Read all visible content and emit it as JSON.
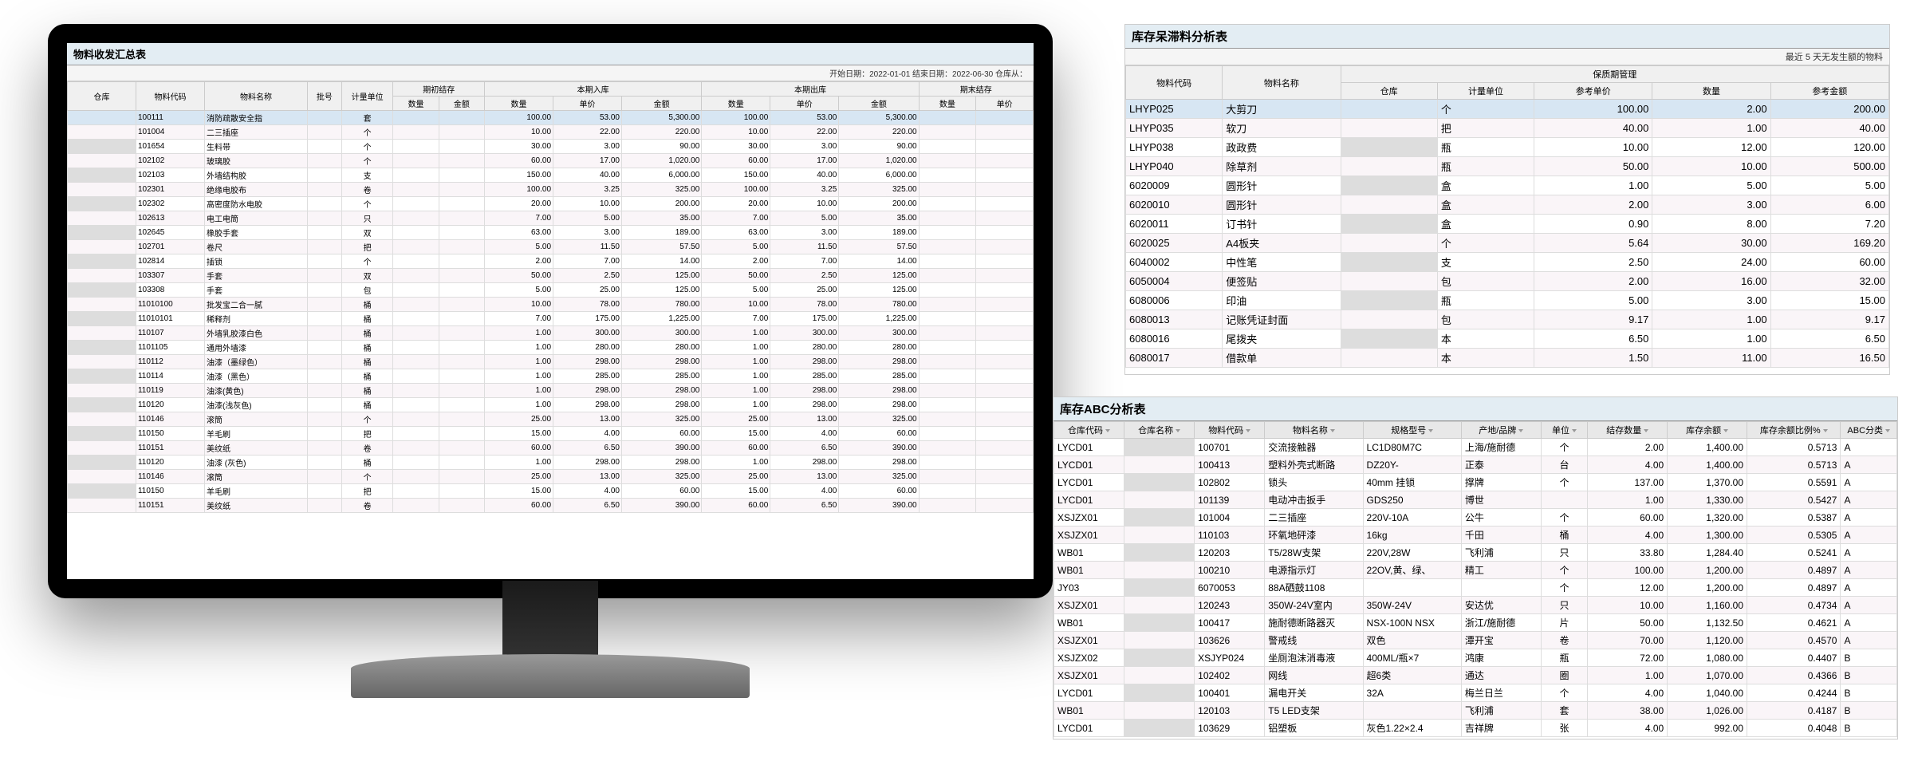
{
  "report1": {
    "title": "物料收发汇总表",
    "date_label": "开始日期：2022-01-01 结束日期：2022-06-30 仓库从：",
    "header_group1": "期初结存",
    "header_group2": "本期入库",
    "header_group3": "本期出库",
    "header_group4": "期末结存",
    "cols": {
      "c1": "仓库",
      "c2": "物料代码",
      "c3": "物料名称",
      "c4": "批号",
      "c5": "计量单位",
      "c6": "数量",
      "c7": "金额",
      "c8": "数量",
      "c9": "单价",
      "c10": "金额",
      "c11": "数量",
      "c12": "单价",
      "c13": "金额",
      "c14": "数量",
      "c15": "单价"
    },
    "rows": [
      {
        "code": "100111",
        "name": "消防疏散安全指",
        "unit": "套",
        "in_qty": "100.00",
        "in_price": "53.00",
        "in_amt": "5,300.00",
        "out_qty": "100.00",
        "out_price": "53.00",
        "out_amt": "5,300.00",
        "hl": true
      },
      {
        "code": "101004",
        "name": "二三插座",
        "unit": "个",
        "in_qty": "10.00",
        "in_price": "22.00",
        "in_amt": "220.00",
        "out_qty": "10.00",
        "out_price": "22.00",
        "out_amt": "220.00"
      },
      {
        "code": "101654",
        "name": "生料带",
        "unit": "个",
        "in_qty": "30.00",
        "in_price": "3.00",
        "in_amt": "90.00",
        "out_qty": "30.00",
        "out_price": "3.00",
        "out_amt": "90.00"
      },
      {
        "code": "102102",
        "name": "玻璃胶",
        "unit": "个",
        "in_qty": "60.00",
        "in_price": "17.00",
        "in_amt": "1,020.00",
        "out_qty": "60.00",
        "out_price": "17.00",
        "out_amt": "1,020.00"
      },
      {
        "code": "102103",
        "name": "外墙结构胶",
        "unit": "支",
        "in_qty": "150.00",
        "in_price": "40.00",
        "in_amt": "6,000.00",
        "out_qty": "150.00",
        "out_price": "40.00",
        "out_amt": "6,000.00"
      },
      {
        "code": "102301",
        "name": "绝缘电胶布",
        "unit": "卷",
        "in_qty": "100.00",
        "in_price": "3.25",
        "in_amt": "325.00",
        "out_qty": "100.00",
        "out_price": "3.25",
        "out_amt": "325.00"
      },
      {
        "code": "102302",
        "name": "高密度防水电胶",
        "unit": "个",
        "in_qty": "20.00",
        "in_price": "10.00",
        "in_amt": "200.00",
        "out_qty": "20.00",
        "out_price": "10.00",
        "out_amt": "200.00"
      },
      {
        "code": "102613",
        "name": "电工电筒",
        "unit": "只",
        "in_qty": "7.00",
        "in_price": "5.00",
        "in_amt": "35.00",
        "out_qty": "7.00",
        "out_price": "5.00",
        "out_amt": "35.00"
      },
      {
        "code": "102645",
        "name": "橡胶手套",
        "unit": "双",
        "in_qty": "63.00",
        "in_price": "3.00",
        "in_amt": "189.00",
        "out_qty": "63.00",
        "out_price": "3.00",
        "out_amt": "189.00"
      },
      {
        "code": "102701",
        "name": "卷尺",
        "unit": "把",
        "in_qty": "5.00",
        "in_price": "11.50",
        "in_amt": "57.50",
        "out_qty": "5.00",
        "out_price": "11.50",
        "out_amt": "57.50"
      },
      {
        "code": "102814",
        "name": "插锁",
        "unit": "个",
        "in_qty": "2.00",
        "in_price": "7.00",
        "in_amt": "14.00",
        "out_qty": "2.00",
        "out_price": "7.00",
        "out_amt": "14.00"
      },
      {
        "code": "103307",
        "name": "手套",
        "unit": "双",
        "in_qty": "50.00",
        "in_price": "2.50",
        "in_amt": "125.00",
        "out_qty": "50.00",
        "out_price": "2.50",
        "out_amt": "125.00"
      },
      {
        "code": "103308",
        "name": "手套",
        "unit": "包",
        "in_qty": "5.00",
        "in_price": "25.00",
        "in_amt": "125.00",
        "out_qty": "5.00",
        "out_price": "25.00",
        "out_amt": "125.00"
      },
      {
        "code": "11010100",
        "name": "批发宝二合一腻",
        "unit": "桶",
        "in_qty": "10.00",
        "in_price": "78.00",
        "in_amt": "780.00",
        "out_qty": "10.00",
        "out_price": "78.00",
        "out_amt": "780.00"
      },
      {
        "code": "11010101",
        "name": "稀释剂",
        "unit": "桶",
        "in_qty": "7.00",
        "in_price": "175.00",
        "in_amt": "1,225.00",
        "out_qty": "7.00",
        "out_price": "175.00",
        "out_amt": "1,225.00"
      },
      {
        "code": "110107",
        "name": "外墙乳胶漆白色",
        "unit": "桶",
        "in_qty": "1.00",
        "in_price": "300.00",
        "in_amt": "300.00",
        "out_qty": "1.00",
        "out_price": "300.00",
        "out_amt": "300.00"
      },
      {
        "code": "1101105",
        "name": "通用外墙漆",
        "unit": "桶",
        "in_qty": "1.00",
        "in_price": "280.00",
        "in_amt": "280.00",
        "out_qty": "1.00",
        "out_price": "280.00",
        "out_amt": "280.00"
      },
      {
        "code": "110112",
        "name": "油漆（墨绿色）",
        "unit": "桶",
        "in_qty": "1.00",
        "in_price": "298.00",
        "in_amt": "298.00",
        "out_qty": "1.00",
        "out_price": "298.00",
        "out_amt": "298.00"
      },
      {
        "code": "110114",
        "name": "油漆（黑色）",
        "unit": "桶",
        "in_qty": "1.00",
        "in_price": "285.00",
        "in_amt": "285.00",
        "out_qty": "1.00",
        "out_price": "285.00",
        "out_amt": "285.00"
      },
      {
        "code": "110119",
        "name": "油漆(黄色)",
        "unit": "桶",
        "in_qty": "1.00",
        "in_price": "298.00",
        "in_amt": "298.00",
        "out_qty": "1.00",
        "out_price": "298.00",
        "out_amt": "298.00"
      },
      {
        "code": "110120",
        "name": "油漆(浅灰色)",
        "unit": "桶",
        "in_qty": "1.00",
        "in_price": "298.00",
        "in_amt": "298.00",
        "out_qty": "1.00",
        "out_price": "298.00",
        "out_amt": "298.00"
      },
      {
        "code": "110146",
        "name": "滚筒",
        "unit": "个",
        "in_qty": "25.00",
        "in_price": "13.00",
        "in_amt": "325.00",
        "out_qty": "25.00",
        "out_price": "13.00",
        "out_amt": "325.00"
      },
      {
        "code": "110150",
        "name": "羊毛刷",
        "unit": "把",
        "in_qty": "15.00",
        "in_price": "4.00",
        "in_amt": "60.00",
        "out_qty": "15.00",
        "out_price": "4.00",
        "out_amt": "60.00"
      },
      {
        "code": "110151",
        "name": "美纹纸",
        "unit": "卷",
        "in_qty": "60.00",
        "in_price": "6.50",
        "in_amt": "390.00",
        "out_qty": "60.00",
        "out_price": "6.50",
        "out_amt": "390.00"
      },
      {
        "code": "110120",
        "name": "油漆 (灰色)",
        "unit": "桶",
        "in_qty": "1.00",
        "in_price": "298.00",
        "in_amt": "298.00",
        "out_qty": "1.00",
        "out_price": "298.00",
        "out_amt": "298.00"
      },
      {
        "code": "110146",
        "name": "滚筒",
        "unit": "个",
        "in_qty": "25.00",
        "in_price": "13.00",
        "in_amt": "325.00",
        "out_qty": "25.00",
        "out_price": "13.00",
        "out_amt": "325.00"
      },
      {
        "code": "110150",
        "name": "羊毛刷",
        "unit": "把",
        "in_qty": "15.00",
        "in_price": "4.00",
        "in_amt": "60.00",
        "out_qty": "15.00",
        "out_price": "4.00",
        "out_amt": "60.00"
      },
      {
        "code": "110151",
        "name": "美纹纸",
        "unit": "卷",
        "in_qty": "60.00",
        "in_price": "6.50",
        "in_amt": "390.00",
        "out_qty": "60.00",
        "out_price": "6.50",
        "out_amt": "390.00"
      }
    ]
  },
  "report2": {
    "title": "库存呆滞料分析表",
    "subtitle": "最近 5 天无发生额的物料",
    "header_group": "保质期管理",
    "cols": {
      "c1": "物料代码",
      "c2": "物料名称",
      "c3": "仓库",
      "c4": "计量单位",
      "c5": "参考单价",
      "c6": "数量",
      "c7": "参考金额"
    },
    "rows": [
      {
        "code": "LHYP025",
        "name": "大剪刀",
        "unit": "个",
        "price": "100.00",
        "qty": "2.00",
        "amt": "200.00",
        "hl": true
      },
      {
        "code": "LHYP035",
        "name": "软刀",
        "unit": "把",
        "price": "40.00",
        "qty": "1.00",
        "amt": "40.00"
      },
      {
        "code": "LHYP038",
        "name": "政政费",
        "unit": "瓶",
        "price": "10.00",
        "qty": "12.00",
        "amt": "120.00"
      },
      {
        "code": "LHYP040",
        "name": "除草剂",
        "unit": "瓶",
        "price": "50.00",
        "qty": "10.00",
        "amt": "500.00"
      },
      {
        "code": "6020009",
        "name": "圆形针",
        "unit": "盒",
        "price": "1.00",
        "qty": "5.00",
        "amt": "5.00"
      },
      {
        "code": "6020010",
        "name": "圆形针",
        "unit": "盒",
        "price": "2.00",
        "qty": "3.00",
        "amt": "6.00"
      },
      {
        "code": "6020011",
        "name": "订书针",
        "unit": "盒",
        "price": "0.90",
        "qty": "8.00",
        "amt": "7.20"
      },
      {
        "code": "6020025",
        "name": "A4板夹",
        "unit": "个",
        "price": "5.64",
        "qty": "30.00",
        "amt": "169.20"
      },
      {
        "code": "6040002",
        "name": "中性笔",
        "unit": "支",
        "price": "2.50",
        "qty": "24.00",
        "amt": "60.00"
      },
      {
        "code": "6050004",
        "name": "便签贴",
        "unit": "包",
        "price": "2.00",
        "qty": "16.00",
        "amt": "32.00"
      },
      {
        "code": "6080006",
        "name": "印油",
        "unit": "瓶",
        "price": "5.00",
        "qty": "3.00",
        "amt": "15.00"
      },
      {
        "code": "6080013",
        "name": "记账凭证封面",
        "unit": "包",
        "price": "9.17",
        "qty": "1.00",
        "amt": "9.17"
      },
      {
        "code": "6080016",
        "name": "尾拨夹",
        "unit": "本",
        "price": "6.50",
        "qty": "1.00",
        "amt": "6.50"
      },
      {
        "code": "6080017",
        "name": "借款单",
        "unit": "本",
        "price": "1.50",
        "qty": "11.00",
        "amt": "16.50"
      }
    ]
  },
  "report3": {
    "title": "库存ABC分析表",
    "cols": {
      "c1": "仓库代码",
      "c2": "仓库名称",
      "c3": "物料代码",
      "c4": "物料名称",
      "c5": "规格型号",
      "c6": "产地/品牌",
      "c7": "单位",
      "c8": "结存数量",
      "c9": "库存余额",
      "c10": "库存余额比例%",
      "c11": "ABC分类"
    },
    "rows": [
      {
        "wh": "LYCD01",
        "code": "100701",
        "name": "交流接触器",
        "spec": "LC1D80M7C",
        "brand": "上海/施耐德",
        "unit": "个",
        "qty": "2.00",
        "bal": "1,400.00",
        "pct": "0.5713",
        "abc": "A"
      },
      {
        "wh": "LYCD01",
        "code": "100413",
        "name": "塑料外壳式断路",
        "spec": "DZ20Y-",
        "brand": "正泰",
        "unit": "台",
        "qty": "4.00",
        "bal": "1,400.00",
        "pct": "0.5713",
        "abc": "A"
      },
      {
        "wh": "LYCD01",
        "code": "102802",
        "name": "锁头",
        "spec": "40mm 挂锁",
        "brand": "撑牌",
        "unit": "个",
        "qty": "137.00",
        "bal": "1,370.00",
        "pct": "0.5591",
        "abc": "A"
      },
      {
        "wh": "LYCD01",
        "code": "101139",
        "name": "电动冲击扳手",
        "spec": "GDS250",
        "brand": "博世",
        "unit": "",
        "qty": "1.00",
        "bal": "1,330.00",
        "pct": "0.5427",
        "abc": "A"
      },
      {
        "wh": "XSJZX01",
        "code": "101004",
        "name": "二三插座",
        "spec": "220V-10A",
        "brand": "公牛",
        "unit": "个",
        "qty": "60.00",
        "bal": "1,320.00",
        "pct": "0.5387",
        "abc": "A"
      },
      {
        "wh": "XSJZX01",
        "code": "110103",
        "name": "环氧地砰漆",
        "spec": "16kg",
        "brand": "千田",
        "unit": "桶",
        "qty": "4.00",
        "bal": "1,300.00",
        "pct": "0.5305",
        "abc": "A"
      },
      {
        "wh": "WB01",
        "code": "120203",
        "name": "T5/28W支架",
        "spec": "220V,28W",
        "brand": "飞利浦",
        "unit": "只",
        "qty": "33.80",
        "bal": "1,284.40",
        "pct": "0.5241",
        "abc": "A"
      },
      {
        "wh": "WB01",
        "code": "100210",
        "name": "电源指示灯",
        "spec": "22OV,黄、绿、",
        "brand": "精工",
        "unit": "个",
        "qty": "100.00",
        "bal": "1,200.00",
        "pct": "0.4897",
        "abc": "A"
      },
      {
        "wh": "JY03",
        "code": "6070053",
        "name": "88A硒鼓1108",
        "spec": "",
        "brand": "",
        "unit": "个",
        "qty": "12.00",
        "bal": "1,200.00",
        "pct": "0.4897",
        "abc": "A"
      },
      {
        "wh": "XSJZX01",
        "code": "120243",
        "name": "350W-24V室内",
        "spec": "350W-24V",
        "brand": "安达优",
        "unit": "只",
        "qty": "10.00",
        "bal": "1,160.00",
        "pct": "0.4734",
        "abc": "A"
      },
      {
        "wh": "WB01",
        "code": "100417",
        "name": "施耐德断路器灭",
        "spec": "NSX-100N NSX",
        "brand": "浙江/施耐德",
        "unit": "片",
        "qty": "50.00",
        "bal": "1,132.50",
        "pct": "0.4621",
        "abc": "A"
      },
      {
        "wh": "XSJZX01",
        "code": "103626",
        "name": "警戒线",
        "spec": "双色",
        "brand": "潭开宝",
        "unit": "卷",
        "qty": "70.00",
        "bal": "1,120.00",
        "pct": "0.4570",
        "abc": "A"
      },
      {
        "wh": "XSJZX02",
        "code": "XSJYP024",
        "name": "坐厕泡沫消毒液",
        "spec": "400ML/瓶×7",
        "brand": "鸿康",
        "unit": "瓶",
        "qty": "72.00",
        "bal": "1,080.00",
        "pct": "0.4407",
        "abc": "B"
      },
      {
        "wh": "XSJZX01",
        "code": "102402",
        "name": "网线",
        "spec": "超6类",
        "brand": "通达",
        "unit": "圈",
        "qty": "1.00",
        "bal": "1,070.00",
        "pct": "0.4366",
        "abc": "B"
      },
      {
        "wh": "LYCD01",
        "code": "100401",
        "name": "漏电开关",
        "spec": "32A",
        "brand": "梅兰日兰",
        "unit": "个",
        "qty": "4.00",
        "bal": "1,040.00",
        "pct": "0.4244",
        "abc": "B"
      },
      {
        "wh": "WB01",
        "code": "120103",
        "name": "T5 LED支架",
        "spec": "",
        "brand": "飞利浦",
        "unit": "套",
        "qty": "38.00",
        "bal": "1,026.00",
        "pct": "0.4187",
        "abc": "B"
      },
      {
        "wh": "LYCD01",
        "code": "103629",
        "name": "铝塑板",
        "spec": "灰色1.22×2.4",
        "brand": "吉祥牌",
        "unit": "张",
        "qty": "4.00",
        "bal": "992.00",
        "pct": "0.4048",
        "abc": "B"
      }
    ]
  }
}
